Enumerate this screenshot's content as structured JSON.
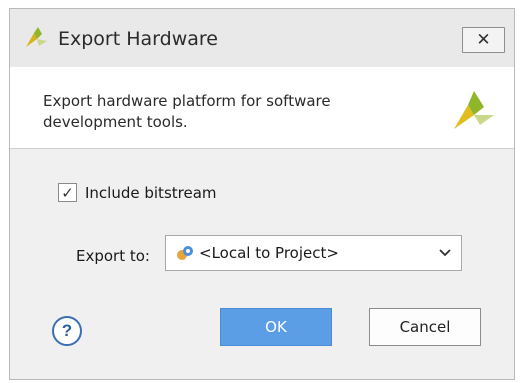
{
  "window": {
    "title": "Export Hardware",
    "close_symbol": "✕",
    "logo_icon": "vivado-logo-icon"
  },
  "header": {
    "description": "Export hardware platform for software development tools.",
    "logo_icon": "vivado-logo-icon"
  },
  "options": {
    "include_bitstream": {
      "label": "Include bitstream",
      "checked": true,
      "mark": "✓"
    }
  },
  "export": {
    "label": "Export to:",
    "selected": "<Local to Project>",
    "icon": "local-project-icon"
  },
  "buttons": {
    "help_symbol": "?",
    "ok": "OK",
    "cancel": "Cancel"
  },
  "colors": {
    "primary_button": "#5b9ee6",
    "logo_green": "#8fb52b",
    "logo_yellow": "#e3c21f"
  }
}
